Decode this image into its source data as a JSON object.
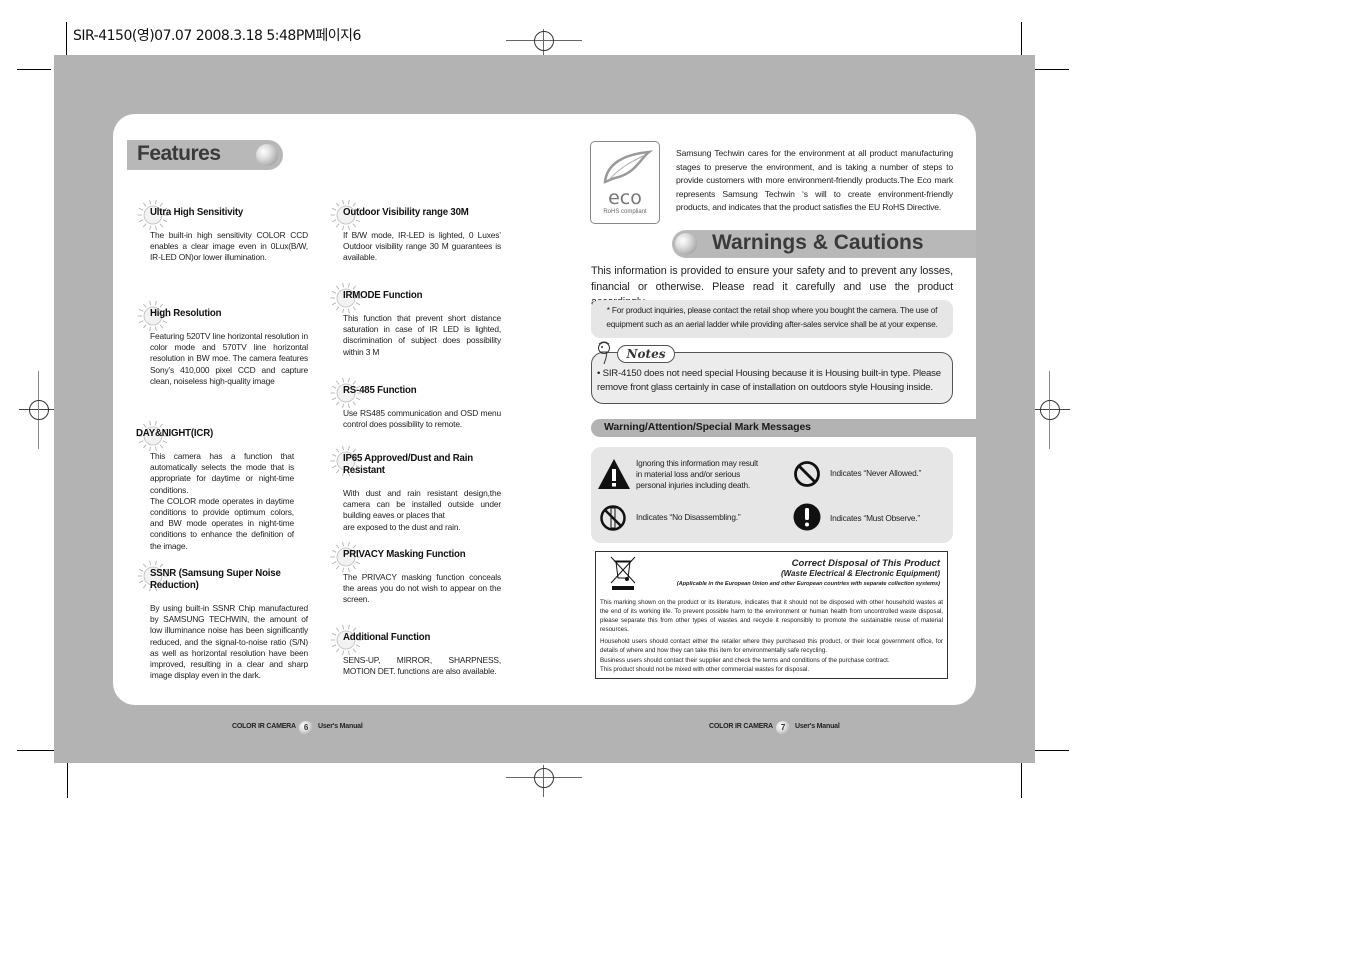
{
  "print_header": "SIR-4150(영)07.07  2008.3.18 5:48PM페이지6",
  "features": {
    "title": "Features",
    "items": [
      {
        "title": "Ultra High Sensitivity",
        "body": "The built-in high sensitivity COLOR CCD enables a clear image even in 0Lux(B/W, IR-LED ON)or lower illumination."
      },
      {
        "title": "High Resolution",
        "body": "Featuring 520TV line horizontal resolution in color mode and 570TV line horizontal resolution in BW moe. The camera features Sony’s 410,000 pixel CCD and capture clean, noiseless high-quality image"
      },
      {
        "title": "DAY&NIGHT(ICR)",
        "body": "This camera has a function that automatically selects the mode that is appropriate for daytime or night-time conditions.\nThe COLOR mode operates in daytime conditions to provide optimum colors, and BW mode operates in night-time conditions to enhance the definition of the image."
      },
      {
        "title": "SSNR (Samsung Super Noise Reduction)",
        "body": "By using built-in SSNR Chip manufactured by SAMSUNG TECHWIN, the amount of low illuminance noise has been significantly reduced, and the signal-to-noise ratio (S/N) as well as horizontal resolution have been improved, resulting in a clear and sharp image display even in the dark."
      },
      {
        "title": "Outdoor Visibility range 30M",
        "body": "If B/W mode, IR-LED is lighted, 0 Luxes’ Outdoor visibility range 30 M guarantees is available."
      },
      {
        "title": "IRMODE Function",
        "body": "This function that prevent short distance saturation in case of IR LED is lighted, discrimination of subject does possibility within 3 M"
      },
      {
        "title": "RS-485 Function",
        "body": "Use RS485 communication and OSD menu control does possibility to remote."
      },
      {
        "title": "IP65 Approved/Dust and Rain Resistant",
        "body": "With dust and rain resistant design,the camera can be installed outside under building eaves or places that\nare exposed to the dust and rain."
      },
      {
        "title": "PRIVACY  Masking Function",
        "body": "The PRIVACY masking function conceals the areas you do not wish to appear on the screen."
      },
      {
        "title": "Additional Function",
        "body": "SENS-UP, MIRROR, SHARPNESS, MOTION DET. functions are also available."
      }
    ]
  },
  "eco": {
    "logo_word": "eco",
    "logo_caption": "RoHS compliant",
    "text": "Samsung Techwin cares for the environment at all product manufacturing stages to preserve the environment, and is taking a number of steps to provide customers with more environment-friendly products.The Eco mark represents Samsung Techwin ‘s will to create environment-friendly products, and indicates that the product satisfies the EU RoHS Directive."
  },
  "warnings": {
    "title": "Warnings & Cautions",
    "intro": "This information is provided to ensure your safety and to prevent any losses, financial or otherwise. Please read it carefully and use the product accordingly.",
    "inquiry": "* For product inquiries, please contact the retail shop where you bought the camera. The use of equipment such as an aerial ladder while providing after-sales service shall be at your expense.",
    "notes_label": "Notes",
    "notes_text": "• SIR-4150 does not need special Housing because it is Housing built-in type. Please remove front glass certainly in case of installation on outdoors style Housing inside.",
    "marks_title": "Warning/Attention/Special Mark Messages",
    "marks": [
      {
        "icon": "warning-triangle-icon",
        "text": "Ignoring this information may result in material loss and/or serious personal injuries including death."
      },
      {
        "icon": "never-allowed-icon",
        "text": "Indicates “Never Allowed.”"
      },
      {
        "icon": "no-disassembling-icon",
        "text": "Indicates “No Disassembling.”"
      },
      {
        "icon": "must-observe-icon",
        "text": "Indicates “Must Observe.”"
      }
    ]
  },
  "disposal": {
    "title": "Correct Disposal of This Product",
    "subtitle": "(Waste Electrical & Electronic Equipment)",
    "applicable": "(Applicable in the European Union and other European countries with separate collection systems)",
    "paragraphs": [
      "This marking shown on the product or its literature, indicates that it should not be disposed with other household wastes at the end of its working life. To prevent possible harm to the environment or human health from uncontrolled waste disposal, please separate this from other types of wastes and recycle it responsibly to promote the sustainable reuse of material resources.",
      "Household users should contact either the retailer where they purchased this product, or their local government office, for details of where and how they can take this item for environmentally safe recycling.",
      "Business users should contact their supplier and check the terms and conditions of the purchase contract.\nThis product should not be mixed with other commercial wastes for disposal."
    ]
  },
  "footer": {
    "left": {
      "product": "COLOR IR CAMERA",
      "page": "6",
      "manual": "User's Manual"
    },
    "right": {
      "product": "COLOR IR CAMERA",
      "page": "7",
      "manual": "User's Manual"
    }
  }
}
